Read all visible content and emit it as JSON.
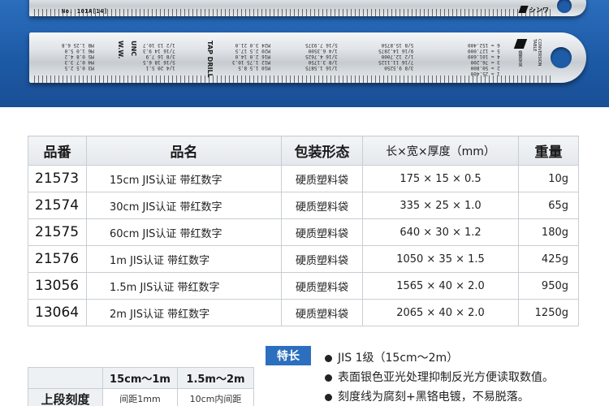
{
  "banner": {
    "ruler_top_model": "No. 101A[14]",
    "ruler_top_brand": "シンワ",
    "ruler_bottom_labels": [
      "W.W.",
      "UNC",
      "TAP DRILL"
    ],
    "ruler_bottom_conv_title": "換算早見",
    "ruler_bottom_conv_sub": "CONVERSION TABLE",
    "ruler_bottom_conv_rows": [
      "1 = 25.400",
      "2 = 50.800",
      "3 = 76.200",
      "4 = 101.600",
      "5 = 127.000",
      "6 = 152.400"
    ],
    "background_color": "#1d5aa6"
  },
  "table": {
    "headers": [
      "品番",
      "品名",
      "包装形态",
      "长×宽×厚度（mm）",
      "重量"
    ],
    "rows": [
      {
        "code": "21573",
        "name": "15cm JIS认证 带红数字",
        "package": "硬质塑料袋",
        "size": "175 × 15 × 0.5",
        "weight": "10g"
      },
      {
        "code": "21574",
        "name": "30cm JIS认证 带红数字",
        "package": "硬质塑料袋",
        "size": "335 × 25 × 1.0",
        "weight": "65g"
      },
      {
        "code": "21575",
        "name": "60cm JIS认证 带红数字",
        "package": "硬质塑料袋",
        "size": "640 × 30 × 1.2",
        "weight": "180g"
      },
      {
        "code": "21576",
        "name": "1m   JIS认证 带红数字",
        "package": "硬质塑料袋",
        "size": "1050 × 35 × 1.5",
        "weight": "425g"
      },
      {
        "code": "13056",
        "name": "1.5m  JIS认证 带红数字",
        "package": "硬质塑料袋",
        "size": "1565 × 40 × 2.0",
        "weight": "950g"
      },
      {
        "code": "13064",
        "name": "2m   JIS认证 带红数字",
        "package": "硬质塑料袋",
        "size": "2065 × 40 × 2.0",
        "weight": "1250g"
      }
    ]
  },
  "features": {
    "badge": "特长",
    "items": [
      "JIS 1级（15cm～2m）",
      "表面银色亚光处理抑制反光方便读取数值。",
      "刻度线为腐刻+黑铬电镀，不易脱落。"
    ]
  },
  "graduation_table": {
    "headers": [
      "",
      "15cm～1m",
      "1.5m～2m"
    ],
    "row_label": "上段刻度",
    "cells": [
      "间距1mm",
      "10cm内间距"
    ]
  }
}
